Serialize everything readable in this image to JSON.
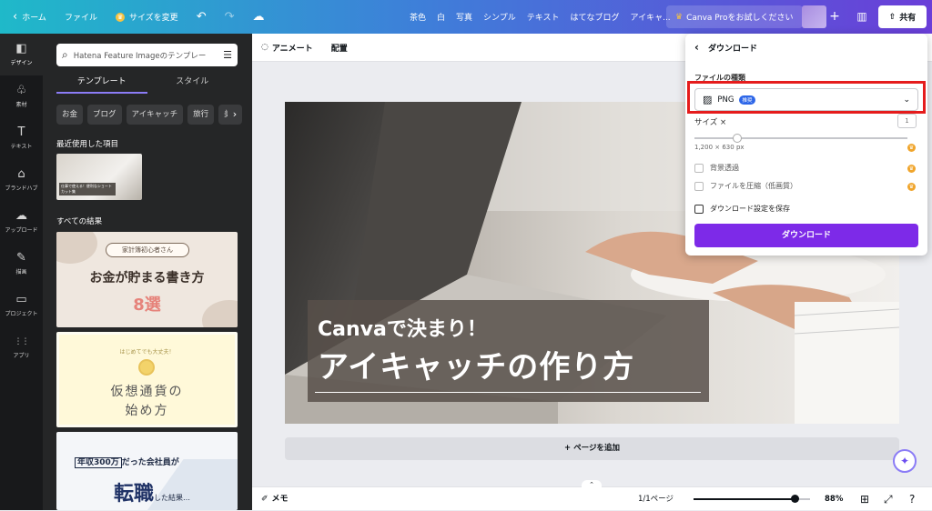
{
  "topbar": {
    "home": "ホーム",
    "file": "ファイル",
    "resize": "サイズを変更",
    "keywords": [
      "茶色",
      "白",
      "写真",
      "シンプル",
      "テキスト",
      "はてなブログ",
      "アイキャ..."
    ],
    "pro": "Canva Proをお試しください",
    "plus": "+",
    "share": "共有"
  },
  "leftnav": {
    "items": [
      {
        "label": "デザイン",
        "icon": "design-icon",
        "glyph": "◧"
      },
      {
        "label": "素材",
        "icon": "elements-icon",
        "glyph": "♧"
      },
      {
        "label": "テキスト",
        "icon": "text-icon",
        "glyph": "T"
      },
      {
        "label": "ブランドハブ",
        "icon": "brand-icon",
        "glyph": "⌂"
      },
      {
        "label": "アップロード",
        "icon": "upload-icon",
        "glyph": "☁"
      },
      {
        "label": "描画",
        "icon": "draw-icon",
        "glyph": "✎"
      },
      {
        "label": "プロジェクト",
        "icon": "folder-icon",
        "glyph": "▭"
      },
      {
        "label": "アプリ",
        "icon": "apps-icon",
        "glyph": "⋮⋮"
      }
    ]
  },
  "panel": {
    "search_placeholder": "Hatena Feature Imageのテンプレー",
    "tabs": [
      "テンプレート",
      "スタイル"
    ],
    "chips": [
      "お金",
      "ブログ",
      "アイキャッチ",
      "旅行",
      "美"
    ],
    "recent_title": "最近使用した項目",
    "recent_caption": "仕事で使える！便利なショートカット集",
    "all_title": "すべての結果",
    "t1": {
      "pill": "家計簿初心者さん",
      "main": "お金が貯まる書き方",
      "num": "8選"
    },
    "t2": {
      "top": "はじめてでも大丈夫！",
      "l1": "仮想通貨の",
      "l2": "始め方"
    },
    "t3": {
      "r1a": "年収300万",
      "r1b": "だった会社員が",
      "r2": "転職",
      "r2b": "した結果…"
    }
  },
  "toolbar": {
    "animate": "アニメート",
    "position": "配置"
  },
  "design": {
    "line1": "Canvaで決まり！",
    "line2": "アイキャッチの作り方"
  },
  "add_page": "+ ページを追加",
  "bottom": {
    "memo": "メモ",
    "pages": "1/1ページ",
    "zoom": "88%",
    "zoom_value": 88
  },
  "download": {
    "title": "ダウンロード",
    "file_type_label": "ファイルの種類",
    "file_type": "PNG",
    "badge": "推奨",
    "size_label": "サイズ ×",
    "size_value": "1",
    "dims": "1,200 × 630 px",
    "opt_bg": "背景透過",
    "opt_compress": "ファイルを圧縮（低画質）",
    "opt_save": "ダウンロード設定を保存",
    "button": "ダウンロード"
  },
  "colors": {
    "accent": "#7d2ae8",
    "highlight": "#e51c1c",
    "panel": "#252627"
  }
}
